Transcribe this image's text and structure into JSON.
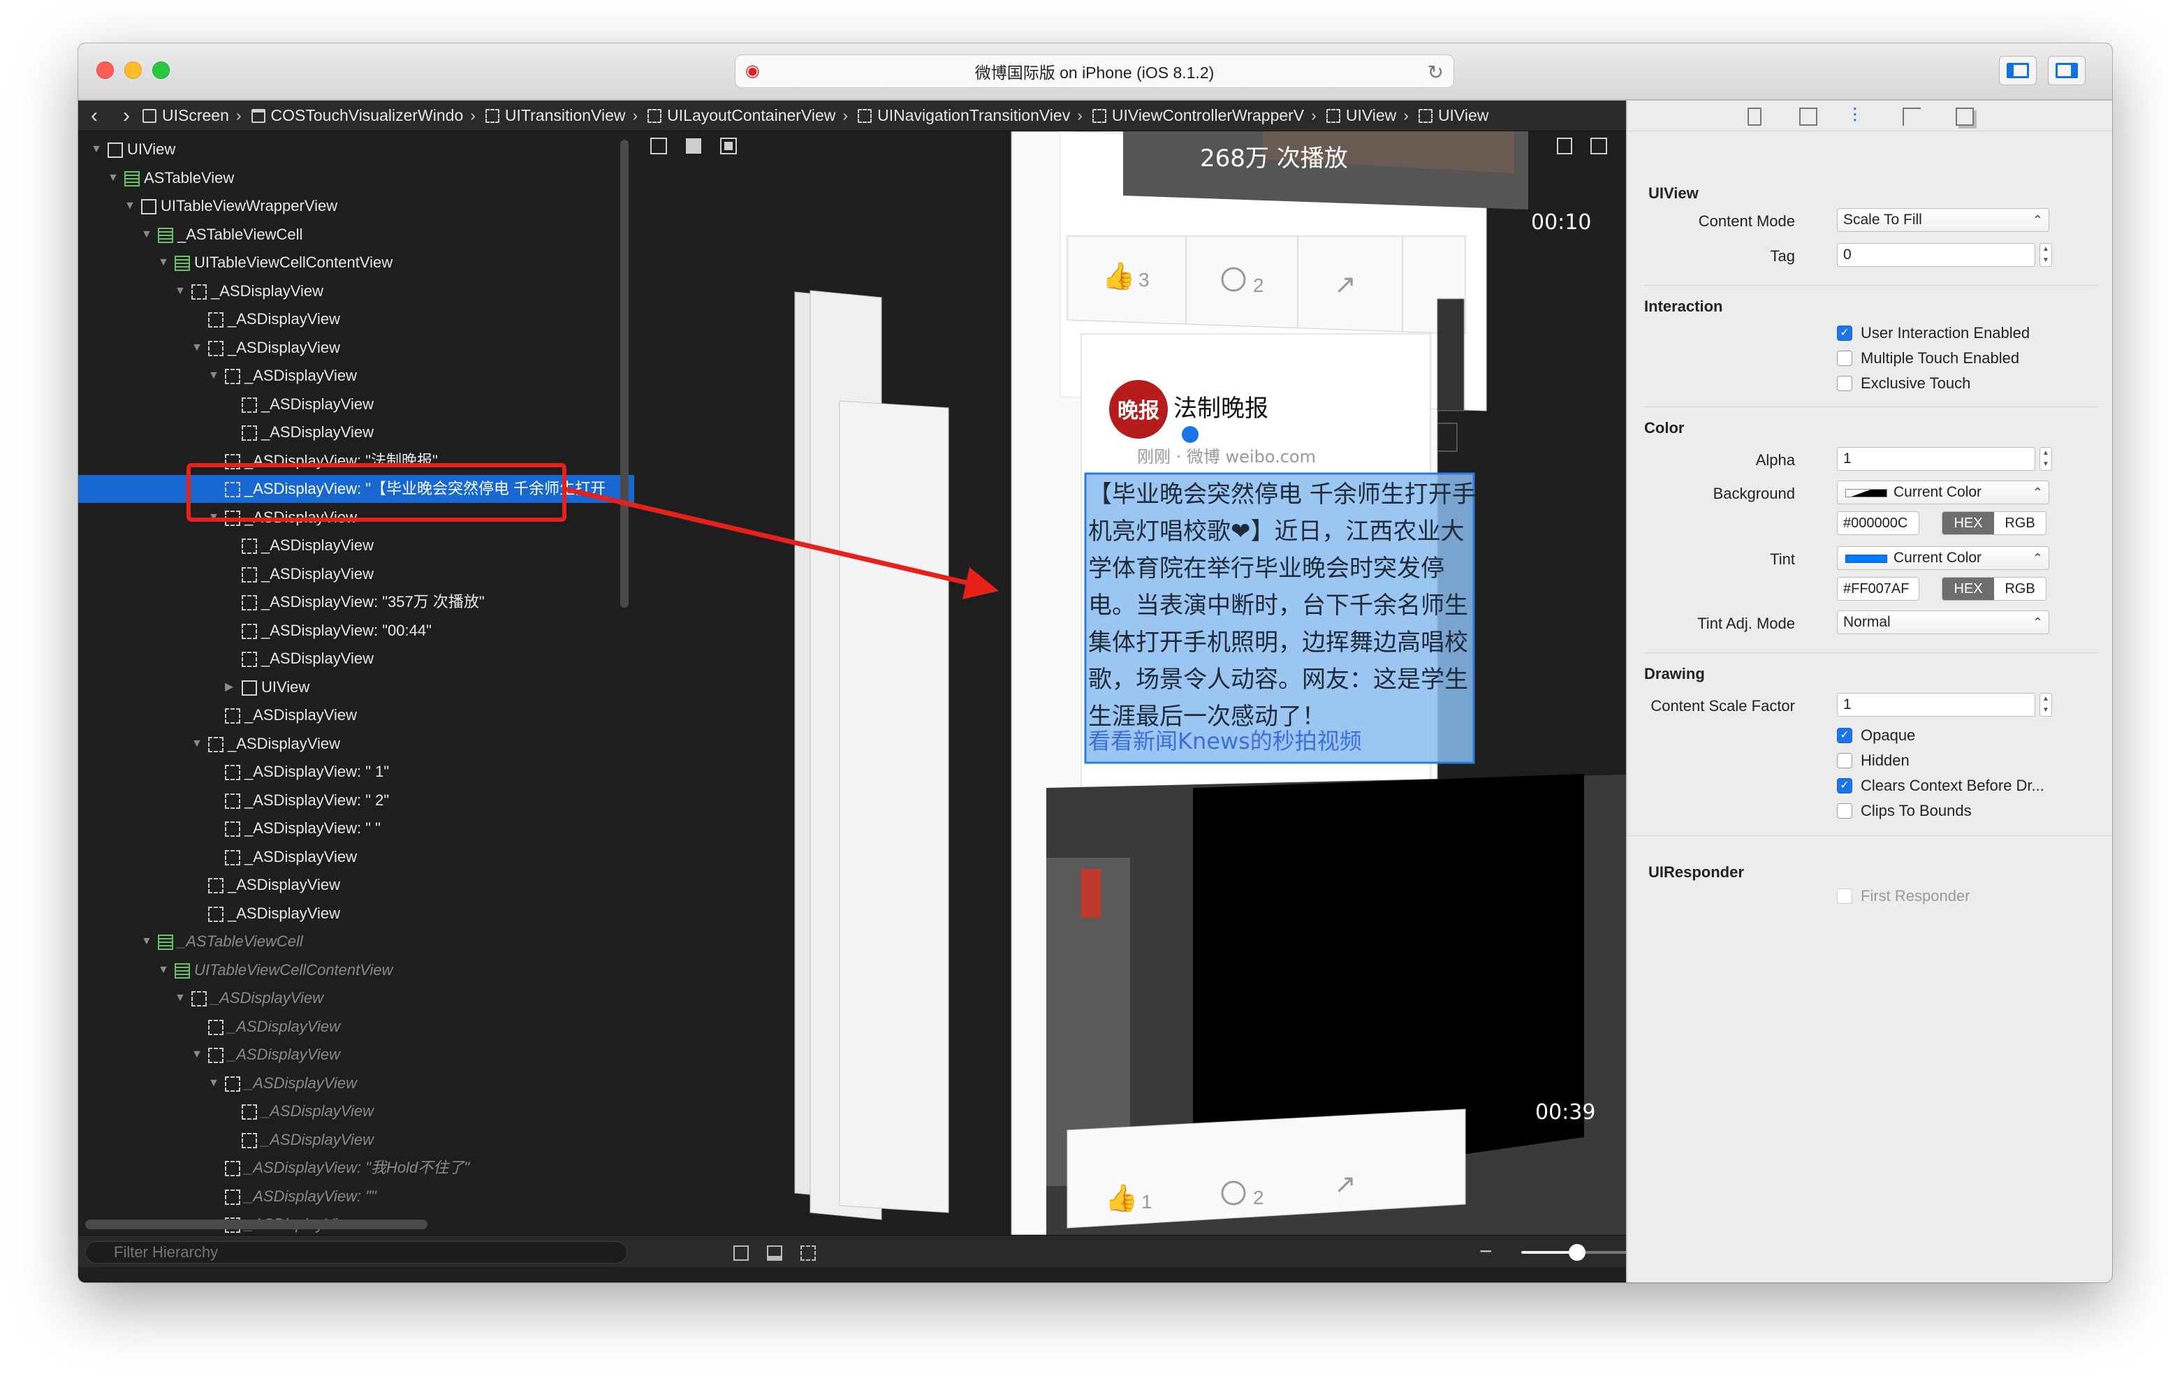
{
  "window": {
    "title": "微博国际版 on iPhone (iOS 8.1.2)"
  },
  "jumpbar": [
    "UIScreen",
    "COSTouchVisualizerWindo",
    "UITransitionView",
    "UILayoutContainerView",
    "UINavigationTransitionViev",
    "UIViewControllerWrapperV",
    "UIView",
    "UIView"
  ],
  "tree": [
    {
      "label": "UIView"
    },
    {
      "label": "ASTableView"
    },
    {
      "label": "UITableViewWrapperView"
    },
    {
      "label": "_ASTableViewCell"
    },
    {
      "label": "UITableViewCellContentView"
    },
    {
      "label": "_ASDisplayView"
    },
    {
      "label": "_ASDisplayView"
    },
    {
      "label": "_ASDisplayView"
    },
    {
      "label": "_ASDisplayView"
    },
    {
      "label": "_ASDisplayView"
    },
    {
      "label": "_ASDisplayView"
    },
    {
      "label": "_ASDisplayView: \"法制晚报\""
    },
    {
      "label": "_ASDisplayView: \"【毕业晚会突然停电 千余师生打开"
    },
    {
      "label": "_ASDisplayView"
    },
    {
      "label": "_ASDisplayView"
    },
    {
      "label": "_ASDisplayView"
    },
    {
      "label": "_ASDisplayView: \"357万 次播放\""
    },
    {
      "label": "_ASDisplayView: \"00:44\""
    },
    {
      "label": "_ASDisplayView"
    },
    {
      "label": "UIView"
    },
    {
      "label": "_ASDisplayView"
    },
    {
      "label": "_ASDisplayView"
    },
    {
      "label": "_ASDisplayView: \" 1\""
    },
    {
      "label": "_ASDisplayView: \" 2\""
    },
    {
      "label": "_ASDisplayView: \" \""
    },
    {
      "label": "_ASDisplayView"
    },
    {
      "label": "_ASDisplayView"
    },
    {
      "label": "_ASDisplayView"
    },
    {
      "label": "_ASTableViewCell"
    },
    {
      "label": "UITableViewCellContentView"
    },
    {
      "label": "_ASDisplayView"
    },
    {
      "label": "_ASDisplayView"
    },
    {
      "label": "_ASDisplayView"
    },
    {
      "label": "_ASDisplayView"
    },
    {
      "label": "_ASDisplayView"
    },
    {
      "label": "_ASDisplayView"
    },
    {
      "label": "_ASDisplayView: \"我Hold不住了\""
    },
    {
      "label": "_ASDisplayView: \"\""
    },
    {
      "label": "_ASDisplayView"
    }
  ],
  "filter": {
    "placeholder": "Filter Hierarchy"
  },
  "preview": {
    "play_count_top": "268万 次播放",
    "duration_top": "00:10",
    "likes_top": "3",
    "comments_top": "2",
    "author": "法制晚报",
    "avatar_text": "晚报",
    "meta": "刚刚 · 微博 weibo.com",
    "post_text": "【毕业晚会突然停电 千余师生打开手机亮灯唱校歌❤】近日，江西农业大学体育院在举行毕业晚会时突发停电。当表演中断时，台下千余名师生集体打开手机照明，边挥舞边高唱校歌，场景令人动容。网友：这是学生生涯最后一次感动了！",
    "video_link": "看看新闻Knews的秒拍视频",
    "duration_bottom": "00:39",
    "likes_bottom": "1",
    "comments_bottom": "2"
  },
  "inspector": {
    "section_uiview": "UIView",
    "content_mode_label": "Content Mode",
    "content_mode_value": "Scale To Fill",
    "tag_label": "Tag",
    "tag_value": "0",
    "section_interaction": "Interaction",
    "user_interaction": "User Interaction Enabled",
    "multiple_touch": "Multiple Touch Enabled",
    "exclusive_touch": "Exclusive Touch",
    "section_color": "Color",
    "alpha_label": "Alpha",
    "alpha_value": "1",
    "background_label": "Background",
    "background_value": "Current Color",
    "background_hex": "#000000C",
    "tint_label": "Tint",
    "tint_value": "Current Color",
    "tint_hex": "#FF007AF",
    "hex_label": "HEX",
    "rgb_label": "RGB",
    "tint_adj_label": "Tint Adj. Mode",
    "tint_adj_value": "Normal",
    "section_drawing": "Drawing",
    "content_scale_label": "Content Scale Factor",
    "content_scale_value": "1",
    "opaque": "Opaque",
    "hidden": "Hidden",
    "clears_context": "Clears Context Before Dr...",
    "clips_to_bounds": "Clips To Bounds",
    "section_responder": "UIResponder",
    "first_responder": "First Responder"
  },
  "colors": {
    "selection": "#1769d1",
    "tint_swatch": "#007AFF",
    "annotation": "#e8201c",
    "checkbox_on": "#1d76e8"
  },
  "zoom": {
    "level": 0.3
  }
}
